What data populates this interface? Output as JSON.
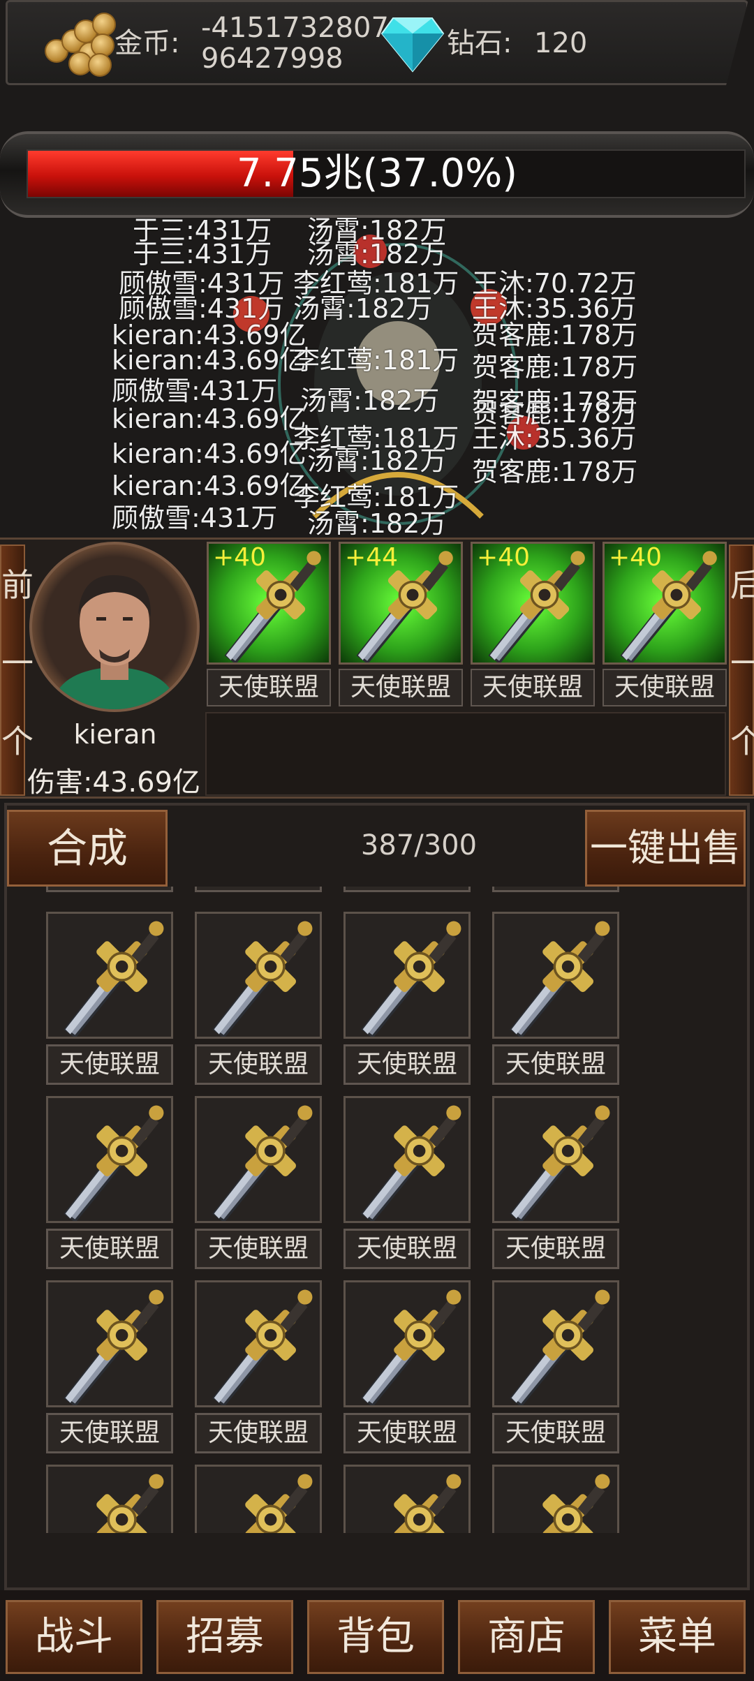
{
  "currency": {
    "gold_label": "金币:",
    "gold_line1": "-4151732807",
    "gold_line2": "96427998",
    "diamond_label": "钻石:",
    "diamond_value": "120"
  },
  "boss": {
    "hp_text": "7.75兆(37.0%)",
    "hp_fraction": 0.37
  },
  "damage_log": [
    "于三:431万",
    "汤霄:182万",
    "于三:431万",
    "汤霄:182万",
    "顾傲雪:431万",
    "李红莺:181万",
    "王沐:70.72万",
    "顾傲雪:431万",
    "汤霄:182万",
    "王沐:35.36万",
    "kieran:43.69亿",
    "贺客鹿:178万",
    "贺客鹿:178万",
    "kieran:43.69亿",
    "李红莺:181万",
    "贺客鹿:178万",
    "顾傲雪:431万",
    "汤霄:182万",
    "贺客鹿:178万",
    "kieran:43.69亿",
    "李红莺:181万",
    "王沐:35.36万",
    "kieran:43.69亿",
    "汤霄:182万",
    "贺客鹿:178万",
    "kieran:43.69亿",
    "李红莺:181万",
    "顾傲雪:431万",
    "汤霄:182万"
  ],
  "hero": {
    "prev_label": "前一个",
    "next_label": "后一个",
    "name": "kieran",
    "damage": "伤害:43.69亿",
    "equipment": [
      {
        "plus": "+40",
        "name": "天使联盟"
      },
      {
        "plus": "+44",
        "name": "天使联盟"
      },
      {
        "plus": "+40",
        "name": "天使联盟"
      },
      {
        "plus": "+40",
        "name": "天使联盟"
      }
    ]
  },
  "inventory": {
    "combine_label": "合成",
    "sell_all_label": "一键出售",
    "count": "387/300",
    "items": [
      "天使联盟",
      "天使联盟",
      "天使联盟",
      "天使联盟",
      "天使联盟",
      "天使联盟",
      "天使联盟",
      "天使联盟",
      "天使联盟",
      "天使联盟",
      "天使联盟",
      "天使联盟"
    ]
  },
  "nav": {
    "battle": "战斗",
    "recruit": "招募",
    "backpack": "背包",
    "shop": "商店",
    "menu": "菜单"
  },
  "icons": [
    "gold-coin-icon",
    "diamond-icon",
    "sword-icon",
    "hero-portrait"
  ],
  "colors": {
    "hp_red": "#d3140d",
    "green_glow": "#3ed21f",
    "wood": "#5a2c13",
    "plus_yellow": "#f6ef3a"
  }
}
